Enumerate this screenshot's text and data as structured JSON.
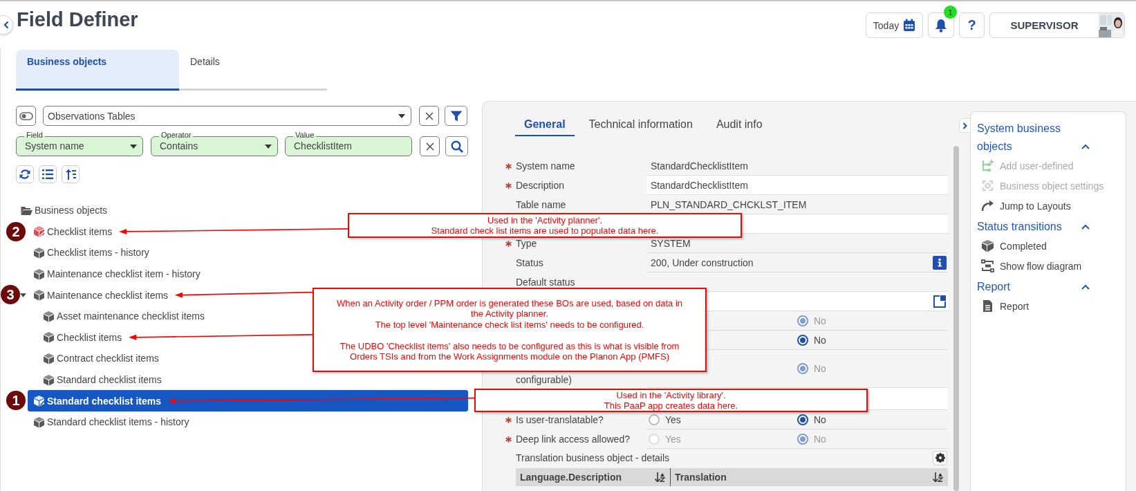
{
  "header": {
    "title": "Field Definer",
    "today": "Today",
    "notification_count": "1",
    "help": "?",
    "user": "SUPERVISOR"
  },
  "left_tabs": [
    {
      "label": "Business objects",
      "selected": true
    },
    {
      "label": "Details",
      "selected": false
    }
  ],
  "filter": {
    "preset": "Observations Tables",
    "conditions": [
      {
        "label": "Field",
        "value": "System name",
        "kind": "dropdown"
      },
      {
        "label": "Operator",
        "value": "Contains",
        "kind": "dropdown"
      },
      {
        "label": "Value",
        "value": "ChecklistItem",
        "kind": "text"
      }
    ]
  },
  "tree": [
    {
      "label": "Business objects",
      "kind": "folder",
      "selected": false,
      "expanded": true,
      "children": [
        {
          "label": "Checklist items",
          "kind": "user-defined",
          "selected": false,
          "marker": "2",
          "callout": "Used in the 'Activity planner'.\nStandard check list items are used to populate data here."
        },
        {
          "label": "Checklist items - history",
          "kind": "system",
          "selected": false
        },
        {
          "label": "Maintenance checklist item - history",
          "kind": "system",
          "selected": false
        },
        {
          "label": "Maintenance checklist items",
          "kind": "system",
          "selected": false,
          "expanded": true,
          "marker": "3",
          "callout": "When an Activity order / PPM order is generated these BOs are used, based on data in\nthe Activity planner.\nThe top level 'Maintenance check list items' needs to be configured.\n\nThe UDBO 'Checklist items' also needs to be configured as this is what is visible from\nOrders TSIs and from the Work Assignments module on the Planon App (PMFS)",
          "children": [
            {
              "label": "Asset maintenance checklist items",
              "kind": "system",
              "selected": false
            },
            {
              "label": "Checklist items",
              "kind": "system",
              "selected": false,
              "arrow": true
            },
            {
              "label": "Contract checklist items",
              "kind": "system",
              "selected": false
            },
            {
              "label": "Standard checklist items",
              "kind": "system",
              "selected": false
            }
          ]
        },
        {
          "label": "Standard checklist items",
          "kind": "user-defined",
          "selected": true,
          "marker": "1",
          "callout": "Used in the 'Activity library'.\nThis PaaP app creates data here."
        },
        {
          "label": "Standard checklist items - history",
          "kind": "system",
          "selected": false
        }
      ]
    }
  ],
  "detail_tabs": [
    {
      "label": "General",
      "selected": true
    },
    {
      "label": "Technical information",
      "selected": false
    },
    {
      "label": "Audit info",
      "selected": false
    }
  ],
  "form_rows": [
    {
      "label": "System name",
      "required": true,
      "kind": "text",
      "value": "StandardChecklistItem"
    },
    {
      "label": "Description",
      "required": true,
      "kind": "field",
      "value": "StandardChecklistItem"
    },
    {
      "label": "Table name",
      "required": false,
      "kind": "text",
      "value": "PLN_STANDARD_CHCKLST_ITEM"
    },
    {
      "kind": "field"
    },
    {
      "label": "Type",
      "required": true,
      "kind": "text",
      "value": "SYSTEM"
    },
    {
      "label": "Status",
      "required": false,
      "kind": "text",
      "value": "200, Under construction",
      "info_button": true
    },
    {
      "label": "Default status",
      "required": false,
      "kind": "text"
    },
    {
      "kind": "field",
      "popup_button": true
    },
    {
      "kind": "radio",
      "options": [
        {
          "label": "No",
          "selected": true,
          "disabled": true
        }
      ]
    },
    {
      "kind": "radio",
      "options": [
        {
          "label": "No",
          "selected": true,
          "disabled": false
        }
      ]
    },
    {
      "label": "configurable)",
      "required": false,
      "kind": "radio",
      "tall": true,
      "options": [
        {
          "label": "No",
          "selected": true,
          "disabled": true
        }
      ]
    },
    {
      "kind": "field"
    },
    {
      "label": "Is user-translatable?",
      "required": true,
      "kind": "radio",
      "options": [
        {
          "label": "Yes",
          "selected": false,
          "disabled": false
        },
        {
          "label": "No",
          "selected": true,
          "disabled": false
        }
      ]
    },
    {
      "label": "Deep link access allowed?",
      "required": true,
      "kind": "radio",
      "options": [
        {
          "label": "Yes",
          "selected": false,
          "disabled": true
        },
        {
          "label": "No",
          "selected": true,
          "disabled": true
        }
      ]
    }
  ],
  "translation": {
    "title": "Translation business object - details",
    "columns": [
      "Language.Description",
      "Translation"
    ]
  },
  "actions": [
    {
      "title": "System business objects",
      "expanded": true,
      "items": [
        {
          "label": "Add user-defined",
          "kind": "add",
          "disabled": true
        },
        {
          "label": "Business object settings",
          "kind": "settings",
          "disabled": true
        },
        {
          "label": "Jump to Layouts",
          "kind": "jump",
          "disabled": false
        }
      ]
    },
    {
      "title": "Status transitions",
      "expanded": true,
      "items": [
        {
          "label": "Completed",
          "kind": "cube",
          "disabled": false
        },
        {
          "label": "Show flow diagram",
          "kind": "flow",
          "disabled": false
        }
      ]
    },
    {
      "title": "Report",
      "expanded": true,
      "items": [
        {
          "label": "Report",
          "kind": "document",
          "disabled": false
        }
      ]
    }
  ]
}
